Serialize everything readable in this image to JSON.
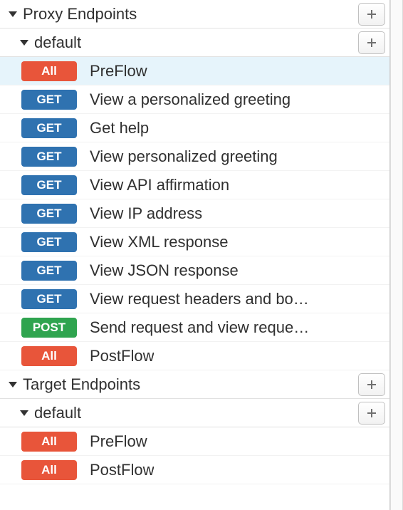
{
  "sections": [
    {
      "title": "Proxy Endpoints",
      "groups": [
        {
          "name": "default",
          "flows": [
            {
              "method": "All",
              "badge": "all",
              "label": "PreFlow",
              "selected": true
            },
            {
              "method": "GET",
              "badge": "get",
              "label": "View a personalized greeting"
            },
            {
              "method": "GET",
              "badge": "get",
              "label": "Get help"
            },
            {
              "method": "GET",
              "badge": "get",
              "label": "View personalized greeting"
            },
            {
              "method": "GET",
              "badge": "get",
              "label": "View API affirmation"
            },
            {
              "method": "GET",
              "badge": "get",
              "label": "View IP address"
            },
            {
              "method": "GET",
              "badge": "get",
              "label": "View XML response"
            },
            {
              "method": "GET",
              "badge": "get",
              "label": "View JSON response"
            },
            {
              "method": "GET",
              "badge": "get",
              "label": "View request headers and bo…"
            },
            {
              "method": "POST",
              "badge": "post",
              "label": "Send request and view reque…"
            },
            {
              "method": "All",
              "badge": "all",
              "label": "PostFlow"
            }
          ]
        }
      ]
    },
    {
      "title": "Target Endpoints",
      "groups": [
        {
          "name": "default",
          "flows": [
            {
              "method": "All",
              "badge": "all",
              "label": "PreFlow"
            },
            {
              "method": "All",
              "badge": "all",
              "label": "PostFlow"
            }
          ]
        }
      ]
    }
  ]
}
